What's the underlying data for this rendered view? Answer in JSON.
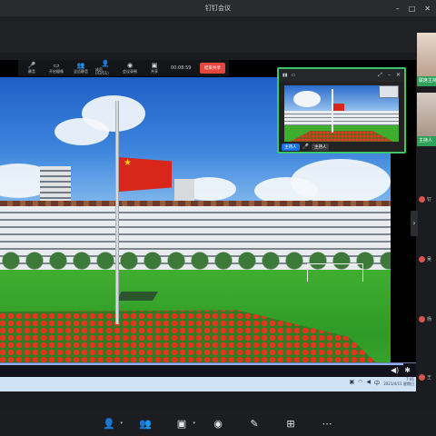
{
  "window": {
    "title": "钉钉会议",
    "controls": [
      "–",
      "□",
      "✕"
    ]
  },
  "share_toolbar": {
    "items": [
      {
        "icon": "mic-icon",
        "glyph": "🎤",
        "label": "静音"
      },
      {
        "icon": "camera-icon",
        "glyph": "▭",
        "label": "开启摄像"
      },
      {
        "icon": "members-icon",
        "glyph": "👥",
        "label": "全员静音"
      },
      {
        "icon": "participants-icon",
        "glyph": "👤",
        "label": "成员(43/51)"
      },
      {
        "icon": "record-icon",
        "glyph": "◉",
        "label": "会议录制"
      },
      {
        "icon": "share-icon",
        "glyph": "▣",
        "label": "共享"
      }
    ],
    "timer": "00:08:59",
    "end_label": "结束共享"
  },
  "player": {
    "progress_percent": 97,
    "icons": [
      "volume-icon",
      "settings-icon"
    ]
  },
  "taskbar": {
    "clock_time": "7:41",
    "clock_date": "2021/4/11 星期日"
  },
  "pip": {
    "badge": "主持人",
    "name": "主持人",
    "mic_glyph": "🎤"
  },
  "right_panel": {
    "label1": "联席主持",
    "label2": "主持人",
    "users": [
      "钉",
      "吴",
      "杨",
      "王"
    ]
  },
  "bottom_toolbar": [
    {
      "icon": "invite-icon",
      "glyph": "👤",
      "caret": "▾"
    },
    {
      "icon": "members-icon",
      "glyph": "👥",
      "caret": ""
    },
    {
      "icon": "share-screen-icon",
      "glyph": "▣",
      "caret": "▾"
    },
    {
      "icon": "record-icon",
      "glyph": "◉",
      "caret": ""
    },
    {
      "icon": "interact-icon",
      "glyph": "✎",
      "caret": ""
    },
    {
      "icon": "layout-icon",
      "glyph": "⊞",
      "caret": ""
    },
    {
      "icon": "more-icon",
      "glyph": "⋯",
      "caret": ""
    }
  ]
}
